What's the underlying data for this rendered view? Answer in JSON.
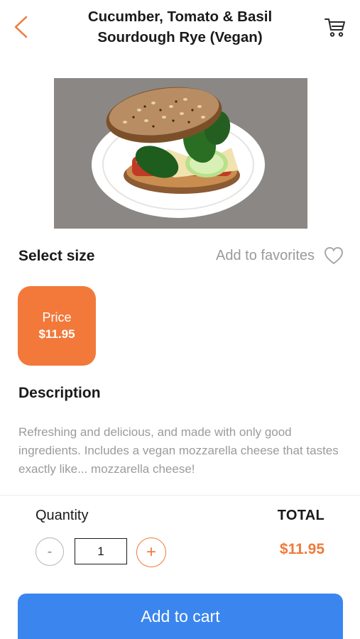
{
  "header": {
    "title": "Cucumber, Tomato & Basil Sourdough Rye (Vegan)",
    "back_icon": "chevron-left-icon",
    "cart_icon": "cart-icon"
  },
  "product": {
    "image_icon": "sandwich-photo"
  },
  "size": {
    "heading": "Select size",
    "favorites_label": "Add to favorites",
    "favorites_icon": "heart-outline-icon",
    "option": {
      "label": "Price",
      "price": "$11.95"
    }
  },
  "description": {
    "heading": "Description",
    "text": "Refreshing and delicious, and made with only good ingredients. Includes a vegan mozzarella cheese that tastes exactly like... mozzarella cheese!"
  },
  "quantity": {
    "label": "Quantity",
    "minus_label": "-",
    "value": "1",
    "plus_label": "+"
  },
  "total": {
    "label": "TOTAL",
    "value": "$11.95"
  },
  "cta": {
    "label": "Add to cart"
  },
  "colors": {
    "accent": "#f2793a",
    "primary_button": "#3b86ee"
  }
}
